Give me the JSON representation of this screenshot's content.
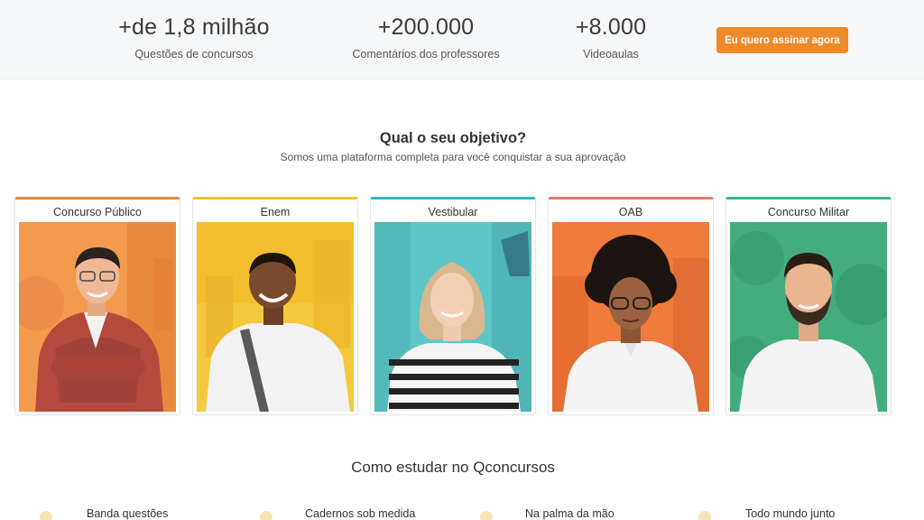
{
  "stats": [
    {
      "value": "+de 1,8 milhão",
      "label": "Questões de concursos"
    },
    {
      "value": "+200.000",
      "label": "Comentários dos professores"
    },
    {
      "value": "+8.000",
      "label": "Videoaulas"
    }
  ],
  "cta_label": "Eu quero assinar agora",
  "objective": {
    "title": "Qual o seu objetivo?",
    "subtitle": "Somos uma plataforma completa para você conquistar a sua aprovação"
  },
  "cards": [
    {
      "label": "Concurso Público",
      "color": "#e98b3a"
    },
    {
      "label": "Enem",
      "color": "#f2c12e"
    },
    {
      "label": "Vestibular",
      "color": "#34b4cc"
    },
    {
      "label": "OAB",
      "color": "#e8766a"
    },
    {
      "label": "Concurso Militar",
      "color": "#3ab58a"
    }
  ],
  "how": {
    "title": "Como estudar no Qconcursos",
    "features": [
      {
        "label": "Banda questões"
      },
      {
        "label": "Cadernos sob medida"
      },
      {
        "label": "Na palma da mão"
      },
      {
        "label": "Todo mundo junto"
      }
    ]
  }
}
